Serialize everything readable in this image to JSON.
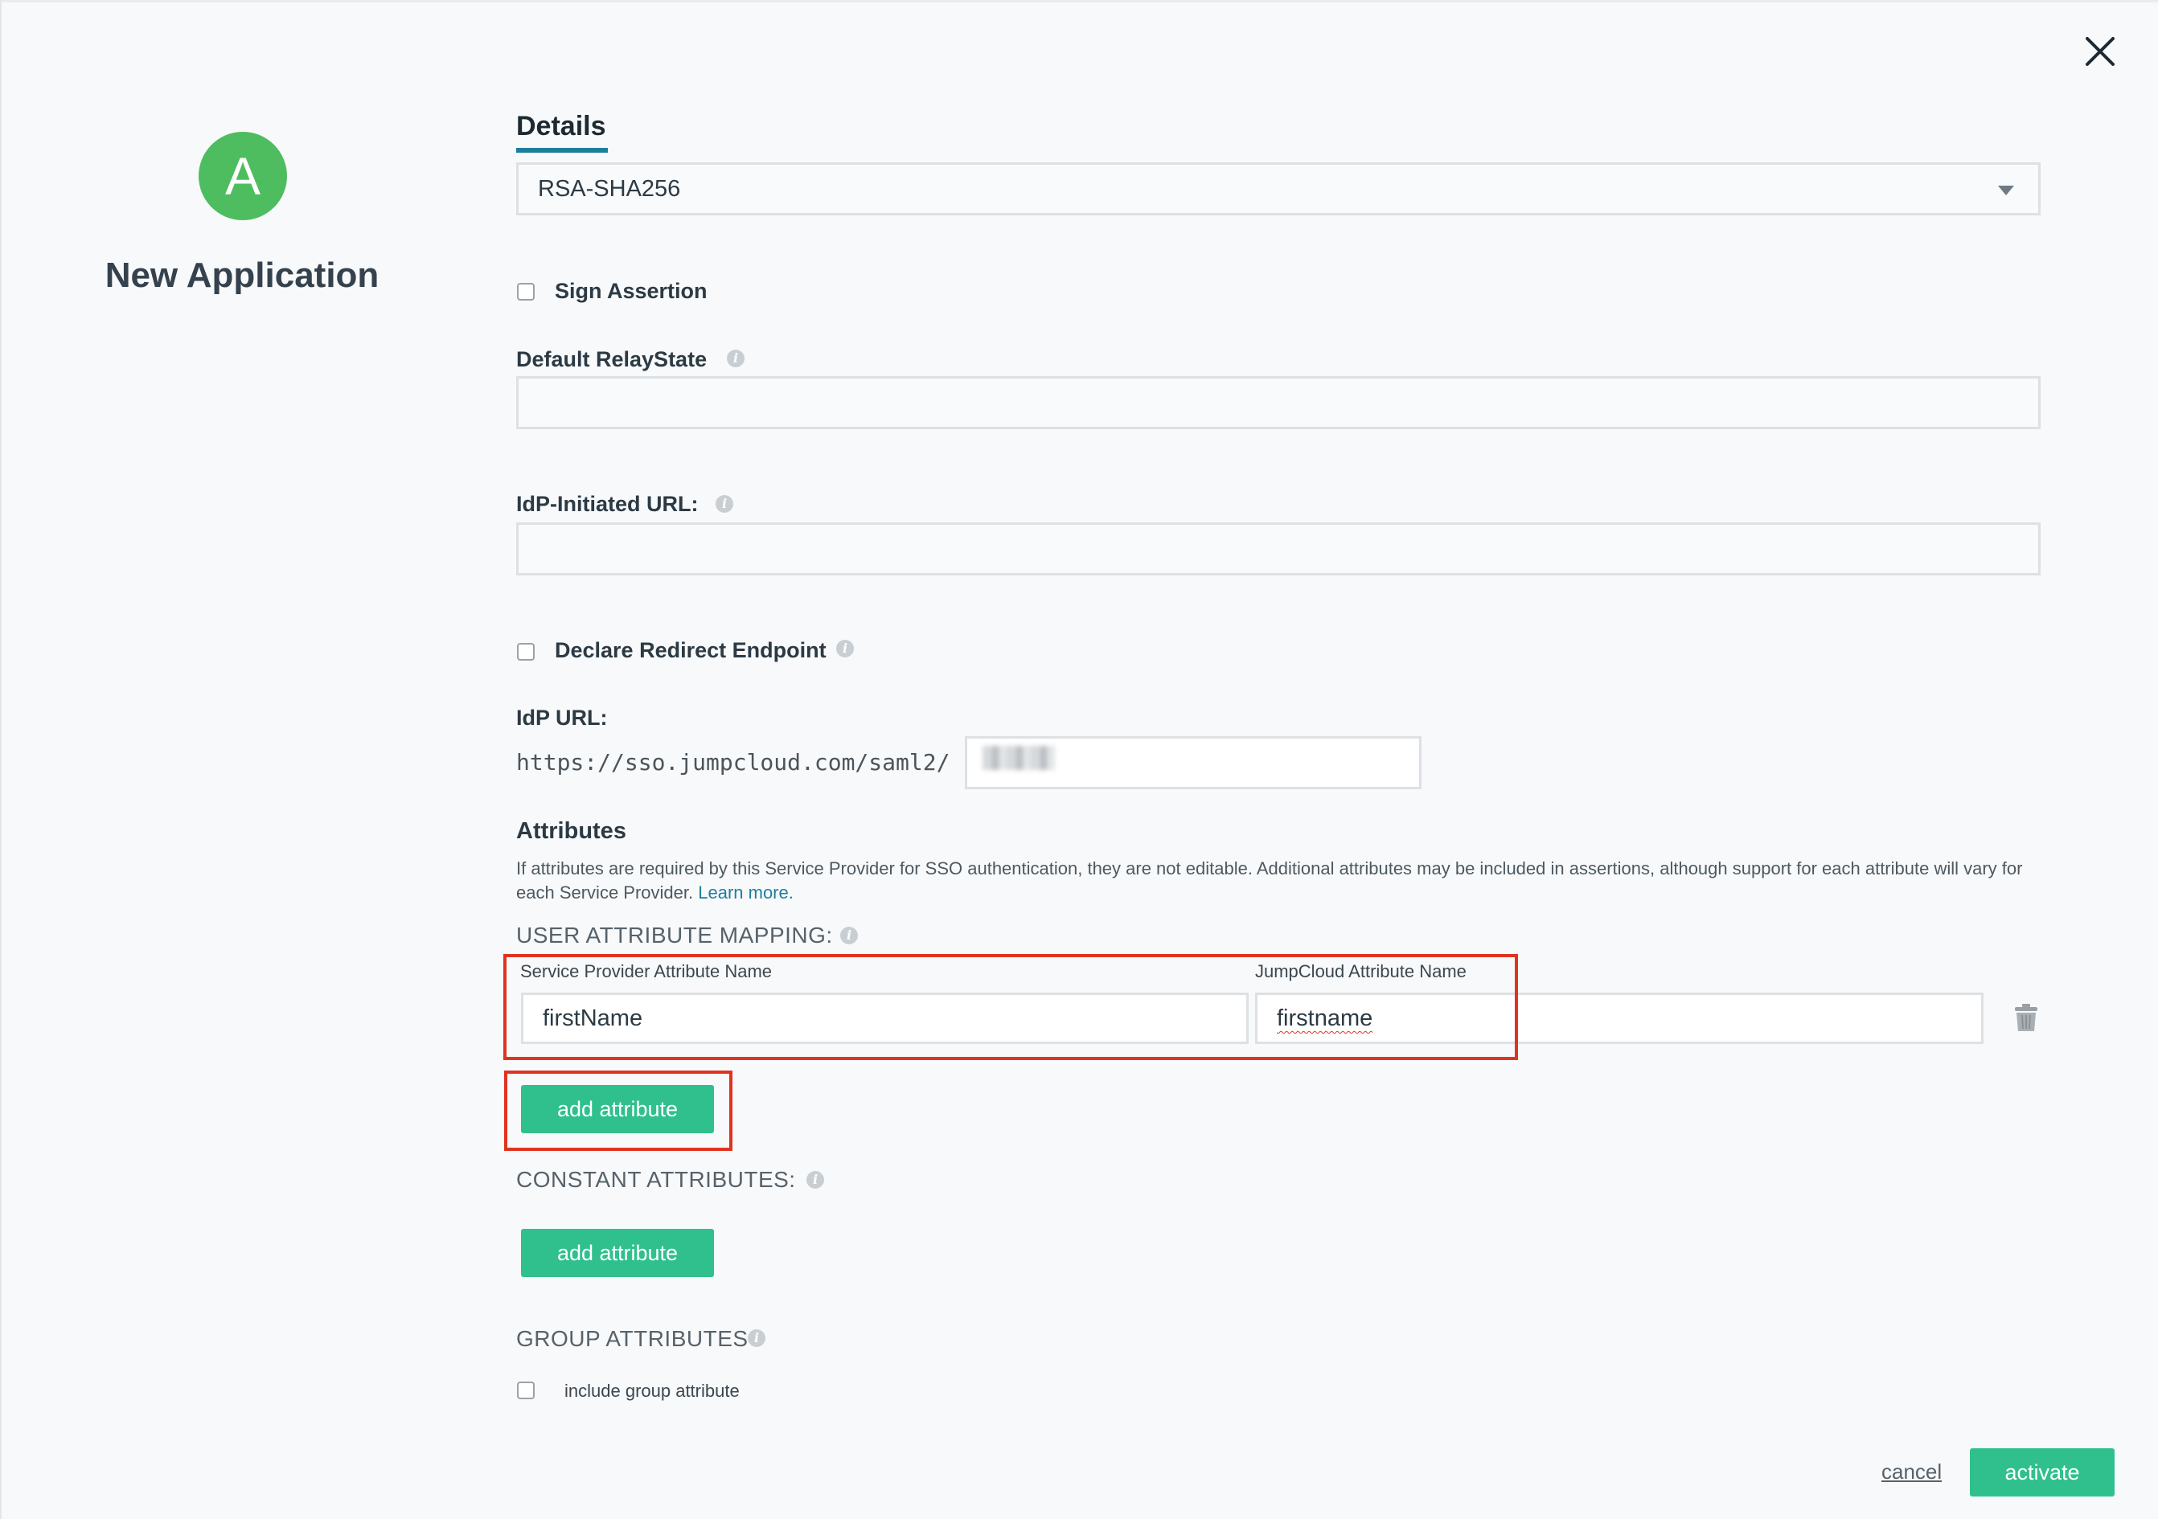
{
  "header": {
    "close_icon": "close-icon"
  },
  "app": {
    "avatar_letter": "A",
    "title": "New Application"
  },
  "tabs": {
    "details": "Details"
  },
  "signature_algorithm": {
    "selected": "RSA-SHA256"
  },
  "sign_assertion": {
    "label": "Sign Assertion",
    "checked": false
  },
  "default_relay_state": {
    "label": "Default RelayState",
    "value": ""
  },
  "idp_initiated_url": {
    "label": "IdP-Initiated URL:",
    "value": ""
  },
  "declare_redirect": {
    "label": "Declare Redirect Endpoint",
    "checked": false
  },
  "idp_url": {
    "label": "IdP URL:",
    "prefix": "https://sso.jumpcloud.com/saml2/",
    "value": ""
  },
  "attributes": {
    "title": "Attributes",
    "description": "If attributes are required by this Service Provider for SSO authentication, they are not editable. Additional attributes may be included in assertions, although support for each attribute will vary for each Service Provider.",
    "learn_more": "Learn more."
  },
  "user_attribute_mapping": {
    "label": "USER ATTRIBUTE MAPPING:",
    "sp_column_label": "Service Provider Attribute Name",
    "jc_column_label": "JumpCloud Attribute Name",
    "rows": [
      {
        "sp_name": "firstName",
        "jc_name": "firstname"
      }
    ],
    "add_button": "add attribute"
  },
  "constant_attributes": {
    "label": "CONSTANT ATTRIBUTES:",
    "add_button": "add attribute"
  },
  "group_attributes": {
    "label": "GROUP ATTRIBUTES",
    "include_label": "include group attribute",
    "checked": false
  },
  "footer": {
    "cancel": "cancel",
    "activate": "activate"
  },
  "colors": {
    "accent": "#2fc08e",
    "avatar": "#4dbd5f",
    "link": "#1f7e9e",
    "highlight": "#e0331f"
  }
}
